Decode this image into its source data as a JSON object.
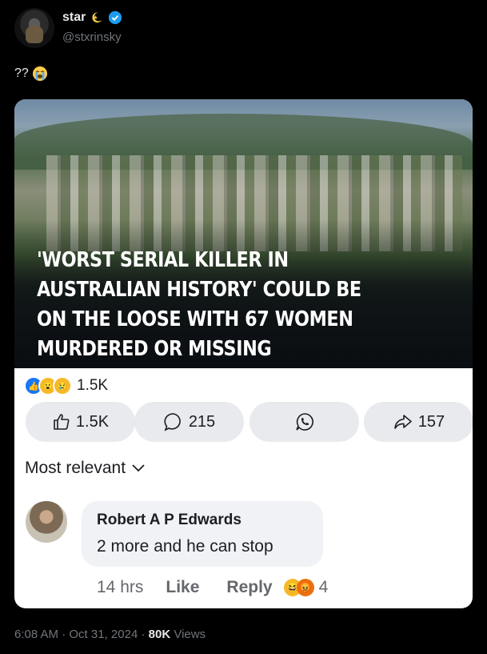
{
  "post": {
    "author_name": "star",
    "handle": "@stxrinsky",
    "text": "??",
    "text_emoji": "loudly-crying-face"
  },
  "card": {
    "headline": "'WORST SERIAL KILLER IN AUSTRALIAN HISTORY' COULD BE ON THE LOOSE WITH 67 WOMEN MURDERED OR MISSING",
    "reaction_count": "1.5K",
    "buttons": {
      "like": "1.5K",
      "comment": "215",
      "share": "157"
    },
    "sort_label": "Most relevant",
    "comment": {
      "author": "Robert A P Edwards",
      "text": "2 more and he can stop",
      "time": "14 hrs",
      "like_label": "Like",
      "reply_label": "Reply",
      "reaction_count": "4"
    }
  },
  "footer": {
    "time": "6:08 AM",
    "date": "Oct 31, 2024",
    "views_count": "80K",
    "views_label": "Views"
  },
  "colors": {
    "background": "#000000",
    "verified_blue": "#1d9bf0",
    "card_bg": "#ffffff",
    "fb_blue": "#1877f2"
  }
}
